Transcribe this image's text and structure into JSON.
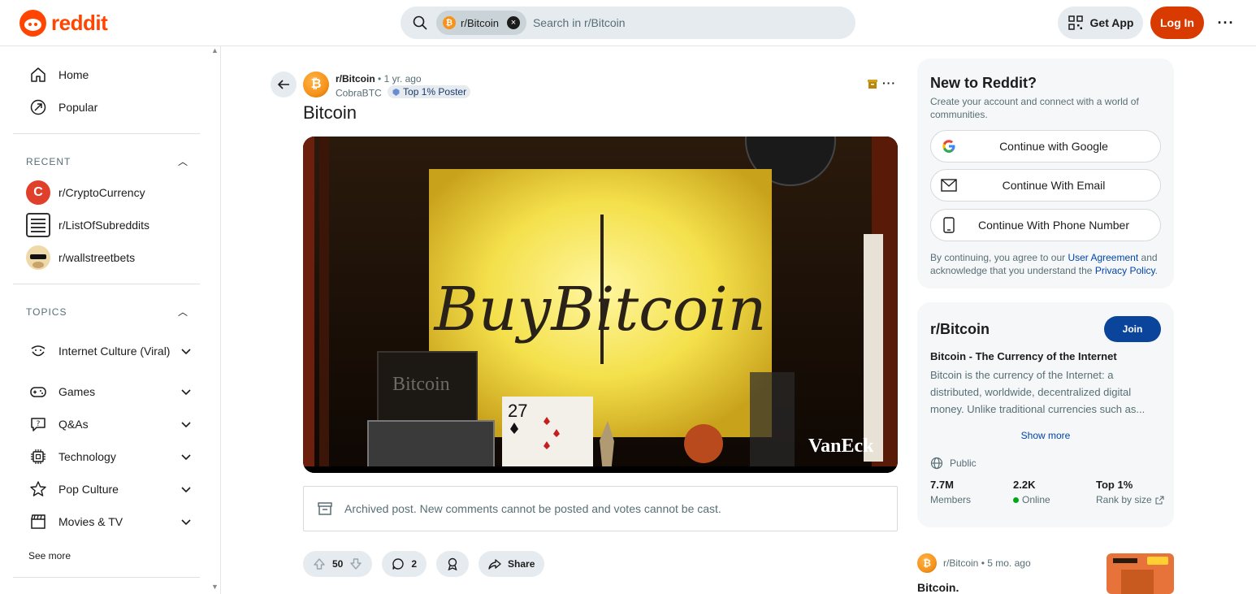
{
  "header": {
    "logo_text": "reddit",
    "search_chip": "r/Bitcoin",
    "search_placeholder": "Search in r/Bitcoin",
    "get_app": "Get App",
    "login": "Log In"
  },
  "sidebar": {
    "nav": [
      {
        "label": "Home",
        "icon": "home-icon"
      },
      {
        "label": "Popular",
        "icon": "popular-icon"
      }
    ],
    "recent_heading": "RECENT",
    "recent": [
      {
        "label": "r/CryptoCurrency",
        "color": "#e0402b"
      },
      {
        "label": "r/ListOfSubreddits",
        "color": "#333333"
      },
      {
        "label": "r/wallstreetbets",
        "color": "#c9a36b"
      }
    ],
    "topics_heading": "TOPICS",
    "topics": [
      {
        "label": "Internet Culture (Viral)",
        "icon": "smile-icon"
      },
      {
        "label": "Games",
        "icon": "gamepad-icon"
      },
      {
        "label": "Q&As",
        "icon": "question-icon"
      },
      {
        "label": "Technology",
        "icon": "chip-icon"
      },
      {
        "label": "Pop Culture",
        "icon": "star-icon"
      },
      {
        "label": "Movies & TV",
        "icon": "clapper-icon"
      }
    ],
    "see_more": "See more"
  },
  "post": {
    "subreddit": "r/Bitcoin",
    "separator": "•",
    "time": "1 yr. ago",
    "author": "CobraBTC",
    "flair": "Top 1% Poster",
    "title": "Bitcoin",
    "media": {
      "sign_text": "BuyBitcoin",
      "book_text": "Bitcoin",
      "card_text": "27",
      "watermark": "VanEck"
    },
    "archived_notice": "Archived post. New comments cannot be posted and votes cannot be cast.",
    "votes": "50",
    "comments": "2",
    "share": "Share"
  },
  "right": {
    "signup": {
      "heading": "New to Reddit?",
      "desc": "Create your account and connect with a world of communities.",
      "google": "Continue with Google",
      "email": "Continue With Email",
      "phone": "Continue With Phone Number",
      "legal_prefix": "By continuing, you agree to our",
      "user_agreement": "User Agreement",
      "legal_mid": "and acknowledge that you understand the",
      "privacy_policy": "Privacy Policy",
      "legal_suffix": "."
    },
    "community": {
      "name": "r/Bitcoin",
      "join": "Join",
      "tagline": "Bitcoin - The Currency of the Internet",
      "about": "Bitcoin is the currency of the Internet: a distributed, worldwide, decentralized digital money. Unlike traditional currencies such as...",
      "show_more": "Show more",
      "visibility": "Public",
      "members_value": "7.7M",
      "members_label": "Members",
      "online_value": "2.2K",
      "online_label": "Online",
      "rank_value": "Top 1%",
      "rank_label": "Rank by size"
    },
    "related": {
      "subreddit": "r/Bitcoin",
      "separator": "•",
      "time": "5 mo. ago",
      "title": "Bitcoin."
    }
  },
  "colors": {
    "brand": "#ff4500",
    "login_bg": "#d93a00",
    "join_bg": "#0a449b",
    "link": "#0045ac",
    "bitcoin": "#f7931a"
  }
}
